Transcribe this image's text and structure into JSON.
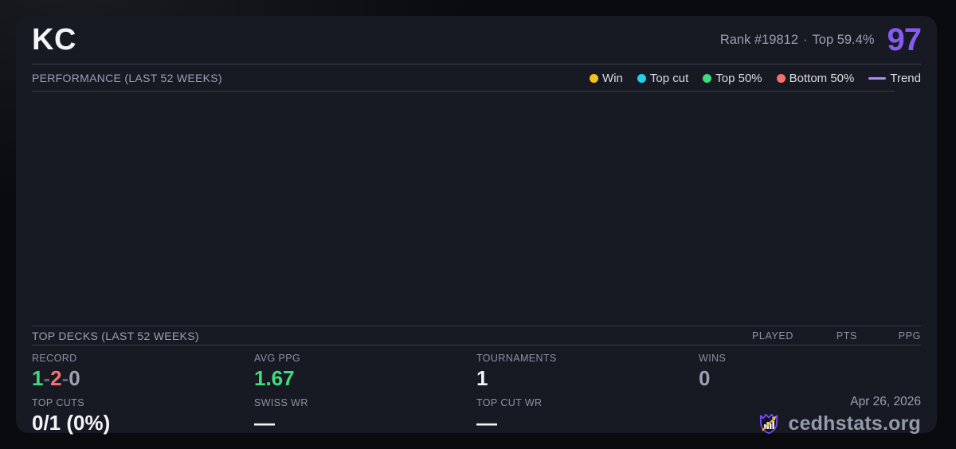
{
  "header": {
    "title": "KC",
    "rank_label": "Rank #19812",
    "separator": "·",
    "top_percent": "Top 59.4%",
    "score": "97"
  },
  "performance": {
    "section_title": "PERFORMANCE (LAST 52 WEEKS)",
    "legend": [
      {
        "label": "Win",
        "color": "#f2c21c"
      },
      {
        "label": "Top cut",
        "color": "#25cfe9"
      },
      {
        "label": "Top 50%",
        "color": "#3fdc7c"
      },
      {
        "label": "Bottom 50%",
        "color": "#f47171"
      },
      {
        "label": "Trend",
        "color": "#a78bfa"
      }
    ],
    "data_points": []
  },
  "top_decks": {
    "section_title": "TOP DECKS (LAST 52 WEEKS)",
    "columns": [
      "PLAYED",
      "PTS",
      "PPG"
    ],
    "rows": []
  },
  "stats": {
    "record": {
      "label": "RECORD",
      "wins": "1",
      "sep1": "-",
      "losses": "2",
      "sep2": "-",
      "draws": "0"
    },
    "avg_ppg": {
      "label": "AVG PPG",
      "value": "1.67"
    },
    "tournaments": {
      "label": "TOURNAMENTS",
      "value": "1"
    },
    "wins": {
      "label": "WINS",
      "value": "0"
    },
    "top_cuts": {
      "label": "TOP CUTS",
      "value": "0/1 (0%)"
    },
    "swiss_wr": {
      "label": "SWISS WR",
      "value": "—"
    },
    "top_cut_wr": {
      "label": "TOP CUT WR",
      "value": "—"
    }
  },
  "footer": {
    "date": "Apr 26, 2026",
    "brand": "cedhstats.org"
  },
  "colors": {
    "accent_purple": "#875af5",
    "green": "#3fdc7c",
    "red": "#f47171",
    "gray": "#9aa2b3",
    "dim": "#5d6370",
    "white": "#f3f4f8"
  }
}
